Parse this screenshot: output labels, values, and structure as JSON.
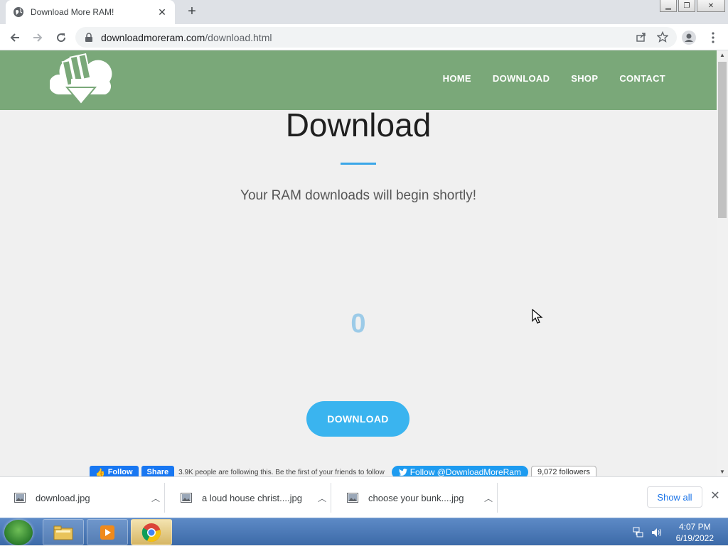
{
  "browser": {
    "tab_title": "Download More RAM!",
    "url_domain": "downloadmoreram.com",
    "url_path": "/download.html"
  },
  "site": {
    "nav": [
      "HOME",
      "DOWNLOAD",
      "SHOP",
      "CONTACT"
    ],
    "page_title": "Download",
    "subtitle": "Your RAM downloads will begin shortly!",
    "counter": "0",
    "download_button": "DOWNLOAD"
  },
  "social": {
    "fb_follow": "Follow",
    "fb_share": "Share",
    "fb_text": "3.9K people are following this. Be the first of your friends to follow",
    "tw_follow": "Follow @DownloadMoreRam",
    "tw_count": "9,072 followers"
  },
  "downloads": {
    "items": [
      "download.jpg",
      "a loud house christ....jpg",
      "choose your bunk....jpg"
    ],
    "show_all": "Show all"
  },
  "taskbar": {
    "time": "4:07 PM",
    "date": "6/19/2022"
  },
  "colors": {
    "header_green": "#7aa879",
    "accent_blue": "#3ab4ef",
    "counter_blue": "#9ccbe8"
  }
}
